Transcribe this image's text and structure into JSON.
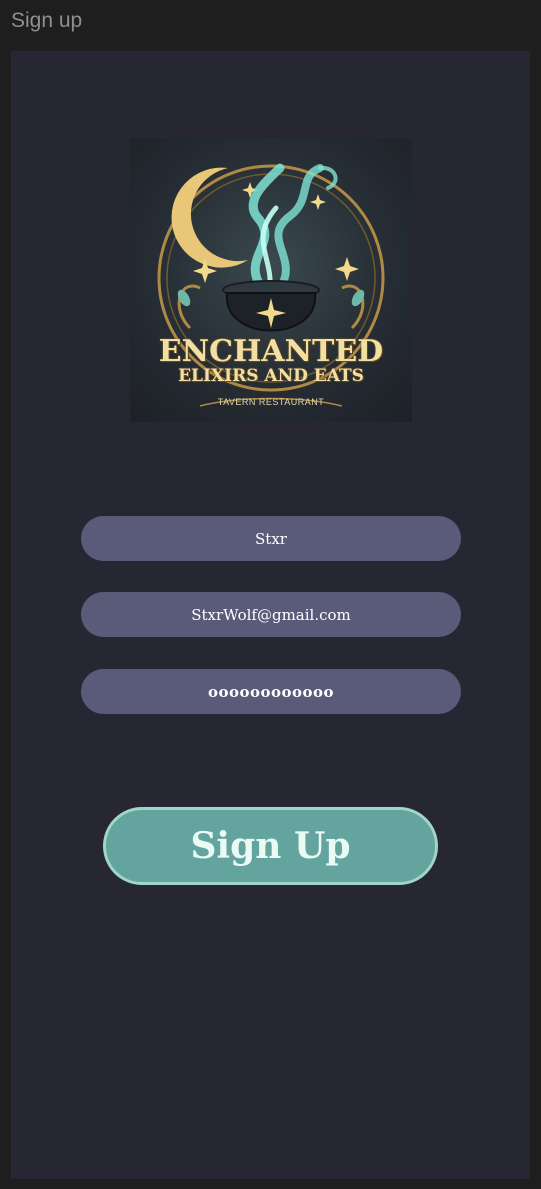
{
  "window": {
    "title": "Sign up"
  },
  "logo": {
    "line1": "ENCHANTED",
    "line2": "ELIXIRS AND EATS",
    "line3": "TAVERN RESTAURANT"
  },
  "form": {
    "username_value": "Stxr",
    "email_value": "StxrWolf@gmail.com",
    "password_value": "oooooooooooo",
    "submit_label": "Sign Up"
  },
  "colors": {
    "background": "#262733",
    "field": "#5a5a79",
    "button": "#64a49f",
    "button_border": "#9fd6c8"
  }
}
